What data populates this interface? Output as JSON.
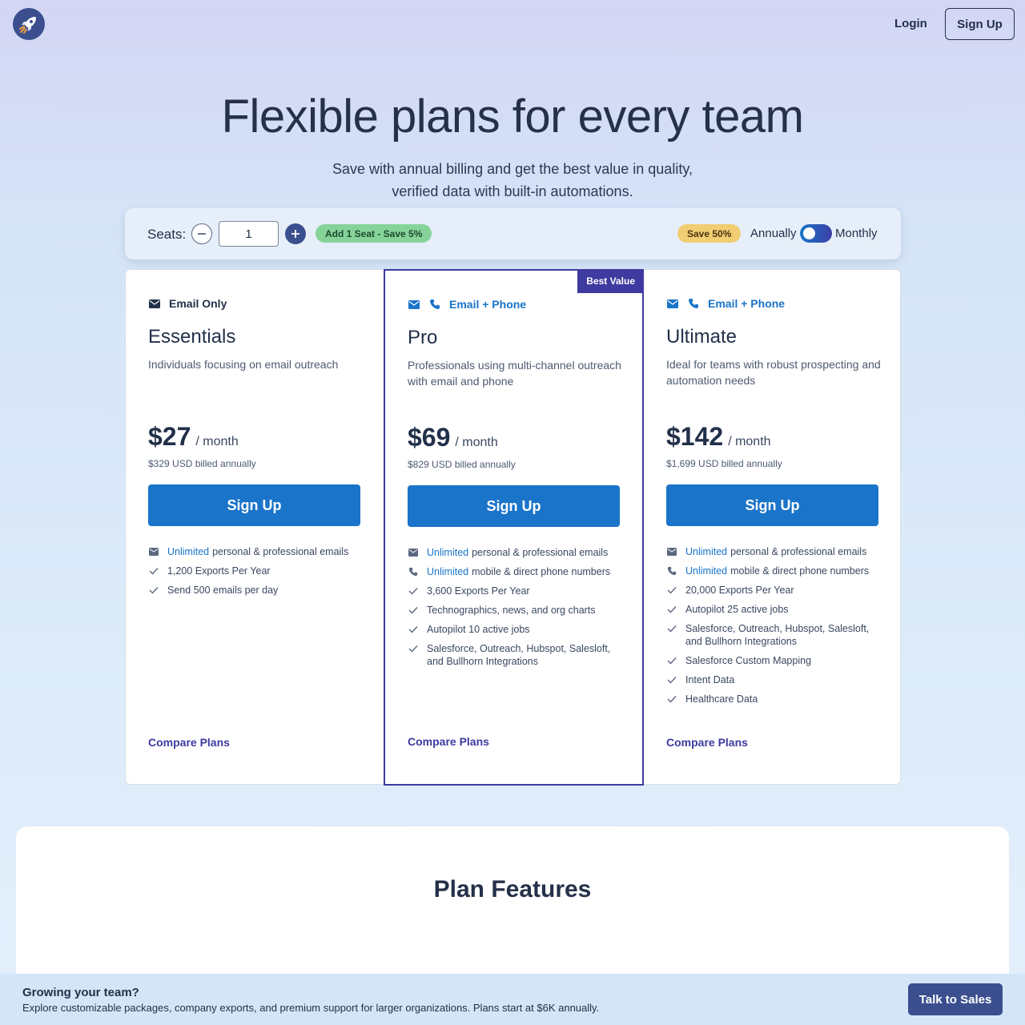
{
  "header": {
    "login_label": "Login",
    "signup_label": "Sign Up"
  },
  "hero": {
    "title": "Flexible plans for every team",
    "subtitle": "Save with annual billing and get the best value in quality, verified data with built-in automations."
  },
  "seats": {
    "label": "Seats:",
    "value": "1",
    "add_badge": "Add 1 Seat - Save 5%",
    "save_badge": "Save 50%",
    "annually_label": "Annually",
    "monthly_label": "Monthly"
  },
  "plans": [
    {
      "channel": "Email Only",
      "name": "Essentials",
      "description": "Individuals focusing on email outreach",
      "price": "$27",
      "per": "/ month",
      "billed": "$329 USD billed annually",
      "cta": "Sign Up",
      "features": [
        {
          "icon": "envelope-icon",
          "highlight": "Unlimited",
          "text": "personal & professional emails"
        },
        {
          "icon": "check-icon",
          "highlight": "",
          "text": "1,200 Exports Per Year"
        },
        {
          "icon": "check-icon",
          "highlight": "",
          "text": "Send 500 emails per day"
        }
      ],
      "compare": "Compare Plans"
    },
    {
      "badge": "Best Value",
      "channel": "Email + Phone",
      "name": "Pro",
      "description": "Professionals using multi-channel outreach with email and phone",
      "price": "$69",
      "per": "/ month",
      "billed": "$829 USD billed annually",
      "cta": "Sign Up",
      "features": [
        {
          "icon": "envelope-icon",
          "highlight": "Unlimited",
          "text": "personal & professional emails"
        },
        {
          "icon": "phone-icon",
          "highlight": "Unlimited",
          "text": "mobile & direct phone numbers"
        },
        {
          "icon": "check-icon",
          "highlight": "",
          "text": "3,600 Exports Per Year"
        },
        {
          "icon": "check-icon",
          "highlight": "",
          "text": "Technographics, news, and org charts"
        },
        {
          "icon": "check-icon",
          "highlight": "",
          "text": "Autopilot 10 active jobs"
        },
        {
          "icon": "check-icon",
          "highlight": "",
          "text": "Salesforce, Outreach, Hubspot, Salesloft, and Bullhorn Integrations"
        }
      ],
      "compare": "Compare Plans"
    },
    {
      "channel": "Email + Phone",
      "name": "Ultimate",
      "description": "Ideal for teams with robust prospecting and automation needs",
      "price": "$142",
      "per": "/ month",
      "billed": "$1,699 USD billed annually",
      "cta": "Sign Up",
      "features": [
        {
          "icon": "envelope-icon",
          "highlight": "Unlimited",
          "text": "personal & professional emails"
        },
        {
          "icon": "phone-icon",
          "highlight": "Unlimited",
          "text": "mobile & direct phone numbers"
        },
        {
          "icon": "check-icon",
          "highlight": "",
          "text": "20,000 Exports Per Year"
        },
        {
          "icon": "check-icon",
          "highlight": "",
          "text": "Autopilot 25 active jobs"
        },
        {
          "icon": "check-icon",
          "highlight": "",
          "text": "Salesforce, Outreach, Hubspot, Salesloft, and Bullhorn Integrations"
        },
        {
          "icon": "check-icon",
          "highlight": "",
          "text": "Salesforce Custom Mapping"
        },
        {
          "icon": "check-icon",
          "highlight": "",
          "text": "Intent Data"
        },
        {
          "icon": "check-icon",
          "highlight": "",
          "text": "Healthcare Data"
        }
      ],
      "compare": "Compare Plans"
    }
  ],
  "plan_features": {
    "title": "Plan Features"
  },
  "banner": {
    "title": "Growing your team?",
    "text": "Explore customizable packages, company exports, and premium support for larger organizations. Plans start at $6K annually.",
    "cta": "Talk to Sales"
  },
  "colors": {
    "accent": "#1a74c9",
    "brand": "#3e3aa0",
    "navy": "#3b4f8f"
  }
}
